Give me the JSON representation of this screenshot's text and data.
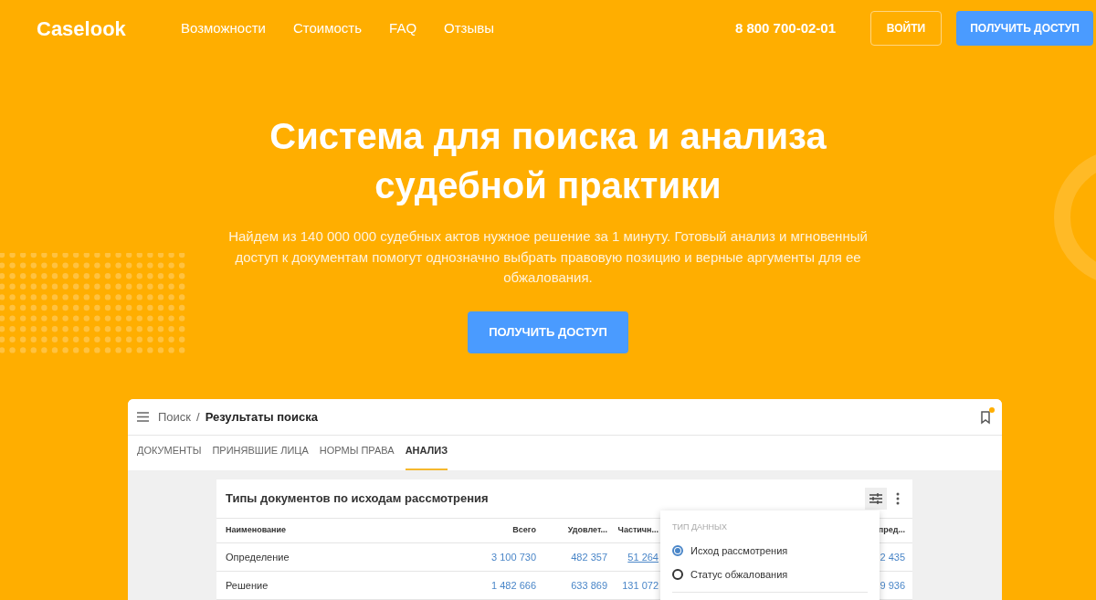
{
  "header": {
    "logo": "Caselook",
    "nav": [
      "Возможности",
      "Стоимость",
      "FAQ",
      "Отзывы"
    ],
    "phone": "8 800 700-02-01",
    "login_button": "ВОЙТИ",
    "access_button": "ПОЛУЧИТЬ ДОСТУП"
  },
  "hero": {
    "title_lines": [
      "Система для поиска и анализа",
      "судебной практики"
    ],
    "description": "Найдем из 140 000 000 судебных актов нужное решение за 1 минуту. Готовый анализ и мгновенный доступ к документам помогут однозначно выбрать правовую позицию и верные аргументы для ее обжалования.",
    "cta_button": "ПОЛУЧИТЬ ДОСТУП"
  },
  "app_preview": {
    "breadcrumb": [
      "Поиск",
      "Результаты поиска"
    ],
    "breadcrumb_separator": "/",
    "bookmark_badge": true,
    "tabs": [
      {
        "label": "ДОКУМЕНТЫ",
        "selected": false
      },
      {
        "label": "ПРИНЯВШИЕ ЛИЦА",
        "selected": false
      },
      {
        "label": "НОРМЫ ПРАВА",
        "selected": false
      },
      {
        "label": "АНАЛИЗ",
        "selected": true
      }
    ],
    "table_card": {
      "title": "Типы документов по исходам рассмотрения",
      "columns": [
        "Наименование",
        "Всего",
        "Удовлет...",
        "Частичн...",
        "пред..."
      ],
      "rows": [
        {
          "cells": [
            "Определение",
            "3 100 730",
            "482 357",
            "51 264",
            "2 435"
          ]
        },
        {
          "cells": [
            "Решение",
            "1 482 666",
            "633 869",
            "131 072",
            "9 936"
          ]
        }
      ]
    },
    "popup": {
      "heading": "ТИП ДАННЫХ",
      "options": [
        {
          "label": "Исход рассмотрения",
          "selected": true
        },
        {
          "label": "Статус обжалования",
          "selected": false
        }
      ]
    }
  }
}
